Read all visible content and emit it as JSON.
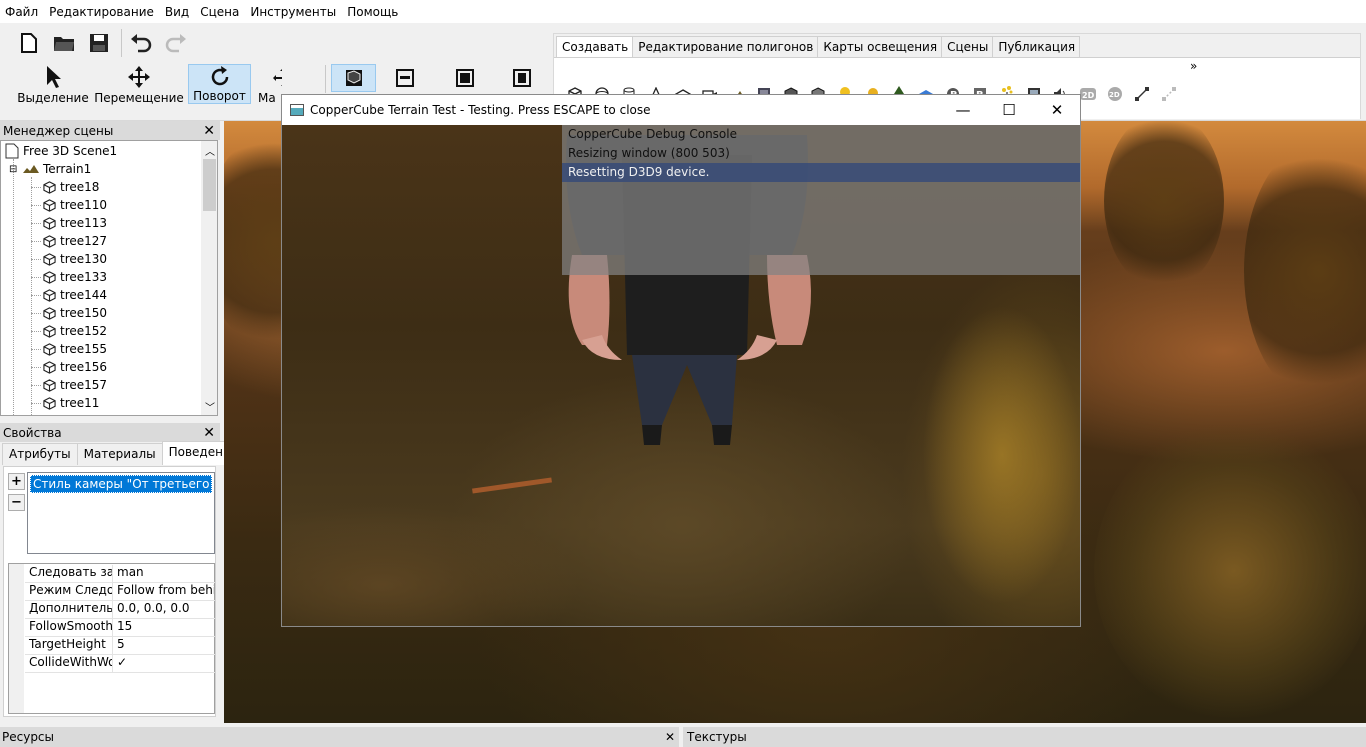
{
  "menu": [
    "Файл",
    "Редактирование",
    "Вид",
    "Сцена",
    "Инструменты",
    "Помощь"
  ],
  "toolbar": {
    "tools": [
      {
        "label": "Выделение"
      },
      {
        "label": "Перемещение"
      },
      {
        "label": "Поворот"
      },
      {
        "label": "Ма"
      }
    ]
  },
  "ribbon": {
    "tabs": [
      "Создавать",
      "Редактирование полигонов",
      "Карты освещения",
      "Сцены",
      "Публикация"
    ],
    "overflow": "»"
  },
  "scene_manager": {
    "title": "Менеджер сцены",
    "root": "Free 3D Scene1",
    "terrain": "Terrain1",
    "items": [
      "tree18",
      "tree110",
      "tree113",
      "tree127",
      "tree130",
      "tree133",
      "tree144",
      "tree150",
      "tree152",
      "tree155",
      "tree156",
      "tree157",
      "tree11"
    ]
  },
  "properties": {
    "title": "Свойства",
    "tabs": [
      "Атрибуты",
      "Материалы",
      "Поведение"
    ],
    "behavior": "Стиль камеры \"От третьего лица\"",
    "add": "+",
    "remove": "−",
    "rows": [
      {
        "key": "Следовать за об",
        "value": "man"
      },
      {
        "key": "Режим Следова",
        "value": "Follow from behind"
      },
      {
        "key": "Дополнительны",
        "value": "0.0, 0.0, 0.0"
      },
      {
        "key": "FollowSmoothin",
        "value": "15"
      },
      {
        "key": "TargetHeight",
        "value": "5"
      },
      {
        "key": "CollideWithWor",
        "value": "✓"
      }
    ]
  },
  "test_window": {
    "title": "CopperCube Terrain Test - Testing. Press ESCAPE to close",
    "minimize": "—",
    "maximize": "☐",
    "close": "✕",
    "console": [
      "CopperCube Debug Console",
      "Resizing window (800 503)",
      "Resetting D3D9 device."
    ]
  },
  "bottom": {
    "resources": "Ресурсы",
    "textures": "Текстуры",
    "close": "✕"
  },
  "colors": {
    "selection": "#0078d7",
    "panel_header": "#dadada",
    "active_tool": "#cce4f7"
  }
}
